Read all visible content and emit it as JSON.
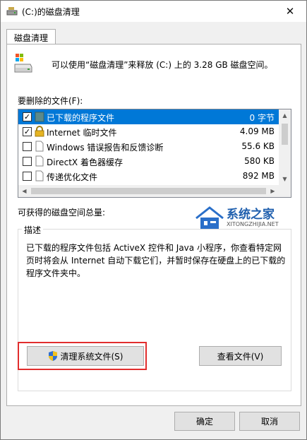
{
  "window": {
    "title": "(C:)的磁盘清理",
    "close_glyph": "✕"
  },
  "tab": {
    "label": "磁盘清理"
  },
  "header": {
    "text": "可以使用“磁盘清理”来释放  (C:) 上的 3.28 GB 磁盘空间。"
  },
  "files_section": {
    "label": "要删除的文件(F):",
    "items": [
      {
        "label": "已下载的程序文件",
        "size": "0 字节",
        "checked": true,
        "selected": true,
        "icon": "folder-icon"
      },
      {
        "label": "Internet 临时文件",
        "size": "4.09 MB",
        "checked": true,
        "selected": false,
        "icon": "lock-icon"
      },
      {
        "label": "Windows 错误报告和反馈诊断",
        "size": "55.6 KB",
        "checked": false,
        "selected": false,
        "icon": "file-icon"
      },
      {
        "label": "DirectX 着色器缓存",
        "size": "580 KB",
        "checked": false,
        "selected": false,
        "icon": "file-icon"
      },
      {
        "label": "传递优化文件",
        "size": "892 MB",
        "checked": false,
        "selected": false,
        "icon": "file-icon"
      }
    ]
  },
  "space_label": "可获得的磁盘空间总量:",
  "watermark": {
    "title": "系统之家",
    "url": "XITONGZHIJIA.NET"
  },
  "description": {
    "legend": "描述",
    "text": "已下载的程序文件包括 ActiveX 控件和 Java 小程序，你查看特定网页时将会从 Internet 自动下载它们，并暂时保存在硬盘上的已下载的程序文件夹中。"
  },
  "buttons": {
    "clean_system": "清理系统文件(S)",
    "view_files": "查看文件(V)",
    "ok": "确定",
    "cancel": "取消"
  },
  "colors": {
    "selection": "#0078d7",
    "highlight_border": "#e12d2d"
  }
}
